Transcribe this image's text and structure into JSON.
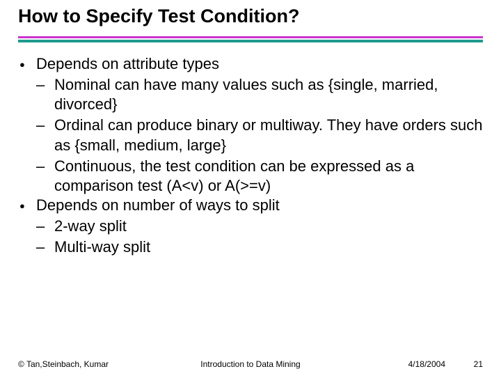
{
  "title": "How to Specify Test Condition?",
  "bullets": [
    {
      "text": "Depends on attribute types",
      "subs": [
        "Nominal can have many values such as {single, married, divorced}",
        "Ordinal can produce binary or multiway. They have orders such as {small, medium, large}",
        "Continuous, the test condition can be expressed as a comparison test (A<v) or A(>=v)"
      ]
    },
    {
      "text": "Depends on number of ways to split",
      "subs": [
        "2-way split",
        "Multi-way split"
      ]
    }
  ],
  "footer": {
    "left": "© Tan,Steinbach, Kumar",
    "center": "Introduction to Data Mining",
    "date": "4/18/2004",
    "page": "21"
  }
}
